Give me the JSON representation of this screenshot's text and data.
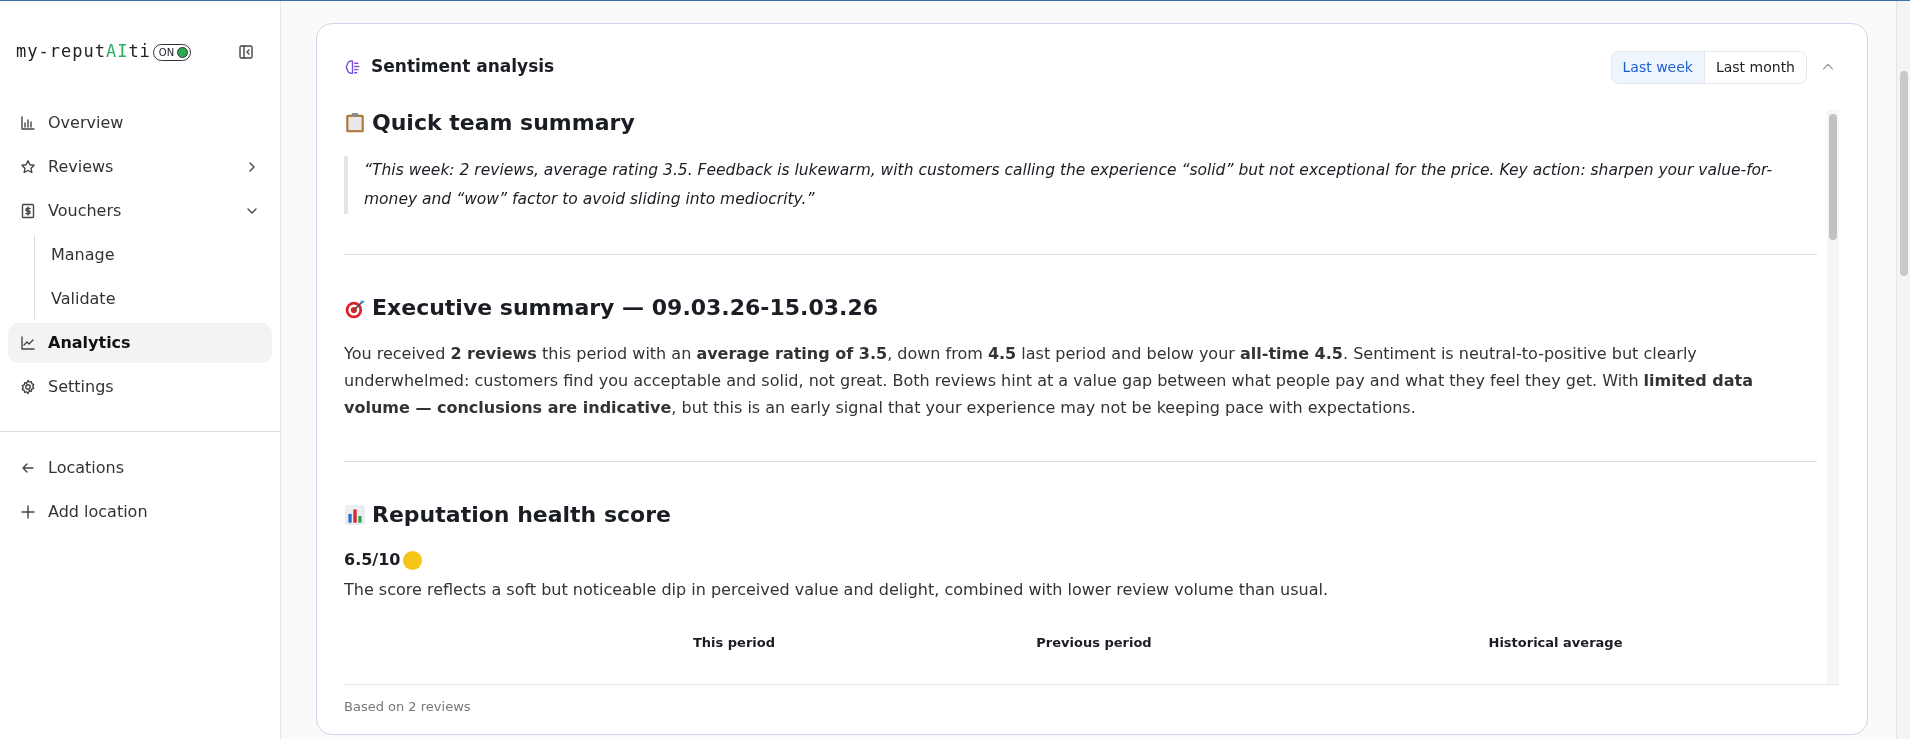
{
  "brand": {
    "before": "my-reput",
    "highlight": "AI",
    "after": "ti",
    "toggle_label": "ON",
    "on": true
  },
  "sidebar": {
    "items": [
      {
        "label": "Overview",
        "selected": false
      },
      {
        "label": "Reviews",
        "selected": false,
        "expanded": false
      },
      {
        "label": "Vouchers",
        "selected": false,
        "expanded": true,
        "children": [
          {
            "label": "Manage",
            "selected": false
          },
          {
            "label": "Validate",
            "selected": false
          }
        ]
      },
      {
        "label": "Analytics",
        "selected": true
      },
      {
        "label": "Settings",
        "selected": false
      }
    ],
    "footer_items": [
      {
        "label": "Locations"
      },
      {
        "label": "Add location"
      }
    ]
  },
  "panel": {
    "title": "Sentiment analysis",
    "periods": [
      {
        "label": "Last week",
        "selected": true
      },
      {
        "label": "Last month",
        "selected": false
      }
    ],
    "expanded": true,
    "sections": [
      {
        "kind": "quote",
        "heading": "Quick team summary",
        "text": "“This week: 2 reviews, average rating 3.5. Feedback is lukewarm, with customers calling the experience “solid” but not exceptional for the price. Key action: sharpen your value-for-money and “wow” factor to avoid sliding into mediocrity.”"
      },
      {
        "kind": "paragraph",
        "heading": "Executive summary — 09.03.26-15.03.26",
        "text": "You received **2 reviews** this period with an **average rating of 3.5**, down from **4.5** last period and below your **all-time 4.5**. Sentiment is neutral-to-positive but clearly underwhelmed: customers find you acceptable and solid, not great. Both reviews hint at a value gap between what people pay and what they feel they get. With **limited data volume — conclusions are indicative**, but this is an early signal that your experience may not be keeping pace with expectations."
      },
      {
        "kind": "score",
        "heading": "Reputation health score",
        "score": "6.5/10",
        "color": "#f5c518",
        "text": "The score reflects a soft but noticeable dip in perceived value and delight, combined with lower review volume than usual.",
        "columns": [
          "This period",
          "Previous period",
          "Historical average"
        ]
      }
    ],
    "footer": "Based on 2 reviews"
  }
}
